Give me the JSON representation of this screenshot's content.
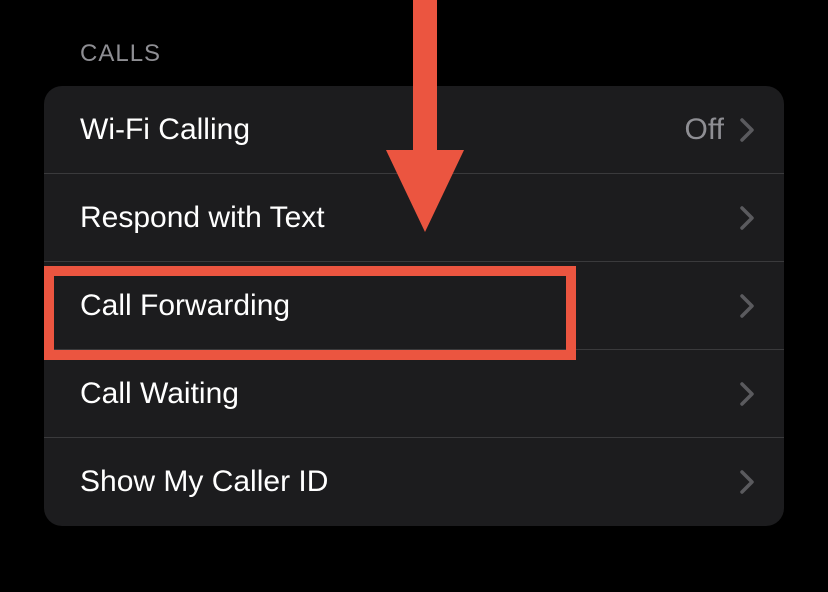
{
  "section_header": "CALLS",
  "rows": [
    {
      "label": "Wi-Fi Calling",
      "value": "Off"
    },
    {
      "label": "Respond with Text",
      "value": ""
    },
    {
      "label": "Call Forwarding",
      "value": ""
    },
    {
      "label": "Call Waiting",
      "value": ""
    },
    {
      "label": "Show My Caller ID",
      "value": ""
    }
  ]
}
